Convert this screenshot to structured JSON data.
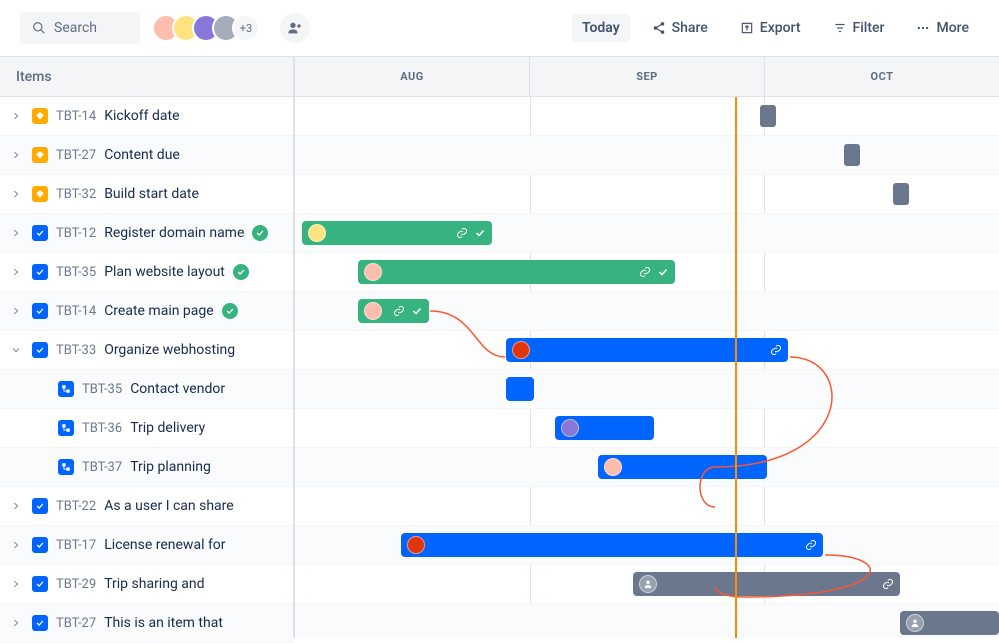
{
  "toolbar": {
    "search_placeholder": "Search",
    "avatar_overflow": "+3",
    "today_label": "Today",
    "share_label": "Share",
    "export_label": "Export",
    "filter_label": "Filter",
    "more_label": "More"
  },
  "timeline": {
    "items_header": "Items",
    "months": [
      "AUG",
      "SEP",
      "OCT"
    ],
    "today_position_pct": 62.5,
    "rows": [
      {
        "key": "TBT-14",
        "title": "Kickoff date",
        "type": "epic",
        "expandable": true,
        "done": false,
        "indent": 0,
        "alt": false,
        "bar": {
          "kind": "diamond",
          "left_pct": 66,
          "color": "gray"
        }
      },
      {
        "key": "TBT-27",
        "title": "Content due",
        "type": "epic",
        "expandable": true,
        "done": false,
        "indent": 0,
        "alt": true,
        "bar": {
          "kind": "diamond",
          "left_pct": 78,
          "color": "gray"
        }
      },
      {
        "key": "TBT-32",
        "title": "Build start date",
        "type": "epic",
        "expandable": true,
        "done": false,
        "indent": 0,
        "alt": false,
        "bar": {
          "kind": "diamond",
          "left_pct": 85,
          "color": "gray"
        }
      },
      {
        "key": "TBT-12",
        "title": "Register domain name",
        "type": "story",
        "expandable": true,
        "done": true,
        "indent": 0,
        "alt": true,
        "bar": {
          "kind": "bar",
          "left_pct": 1,
          "width_pct": 27,
          "color": "green",
          "avatar": "b1",
          "link": true,
          "check": true
        }
      },
      {
        "key": "TBT-35",
        "title": "Plan website layout",
        "type": "story",
        "expandable": true,
        "done": true,
        "indent": 0,
        "alt": false,
        "bar": {
          "kind": "bar",
          "left_pct": 9,
          "width_pct": 45,
          "color": "green",
          "avatar": "b2",
          "link": true,
          "check": true
        }
      },
      {
        "key": "TBT-14",
        "title": "Create main page",
        "type": "story",
        "expandable": true,
        "done": true,
        "indent": 0,
        "alt": true,
        "bar": {
          "kind": "bar",
          "left_pct": 9,
          "width_pct": 10,
          "color": "green",
          "avatar": "b2",
          "link": true,
          "check": true
        }
      },
      {
        "key": "TBT-33",
        "title": "Organize webhosting",
        "type": "story",
        "expandable": true,
        "expanded": true,
        "done": false,
        "indent": 0,
        "alt": false,
        "bar": {
          "kind": "bar",
          "left_pct": 30,
          "width_pct": 40,
          "color": "blue",
          "avatar": "b3",
          "link": true
        }
      },
      {
        "key": "TBT-35",
        "title": "Contact vendor",
        "type": "subtask",
        "expandable": false,
        "done": false,
        "indent": 1,
        "alt": true,
        "bar": {
          "kind": "bar",
          "left_pct": 30,
          "width_pct": 4,
          "color": "blue"
        }
      },
      {
        "key": "TBT-36",
        "title": "Trip delivery",
        "type": "subtask",
        "expandable": false,
        "done": false,
        "indent": 1,
        "alt": false,
        "bar": {
          "kind": "bar",
          "left_pct": 37,
          "width_pct": 14,
          "color": "blue",
          "avatar": "b4"
        }
      },
      {
        "key": "TBT-37",
        "title": "Trip planning",
        "type": "subtask",
        "expandable": false,
        "done": false,
        "indent": 1,
        "alt": true,
        "bar": {
          "kind": "bar",
          "left_pct": 43,
          "width_pct": 24,
          "color": "blue",
          "avatar": "b2"
        }
      },
      {
        "key": "TBT-22",
        "title": "As a user I can share",
        "type": "story",
        "expandable": true,
        "done": false,
        "indent": 0,
        "alt": false,
        "bar": null
      },
      {
        "key": "TBT-17",
        "title": "License renewal for",
        "type": "story",
        "expandable": true,
        "done": false,
        "indent": 0,
        "alt": true,
        "bar": {
          "kind": "bar",
          "left_pct": 15,
          "width_pct": 60,
          "color": "blue",
          "avatar": "b3",
          "link": true
        }
      },
      {
        "key": "TBT-29",
        "title": "Trip sharing and",
        "type": "story",
        "expandable": true,
        "done": false,
        "indent": 0,
        "alt": false,
        "bar": {
          "kind": "bar",
          "left_pct": 48,
          "width_pct": 38,
          "color": "gray",
          "avatar": "generic",
          "link": true
        }
      },
      {
        "key": "TBT-27",
        "title": "This is an item that",
        "type": "story",
        "expandable": true,
        "done": false,
        "indent": 0,
        "alt": true,
        "bar": {
          "kind": "bar",
          "left_pct": 86,
          "width_pct": 14,
          "color": "gray",
          "avatar": "generic"
        }
      }
    ]
  }
}
